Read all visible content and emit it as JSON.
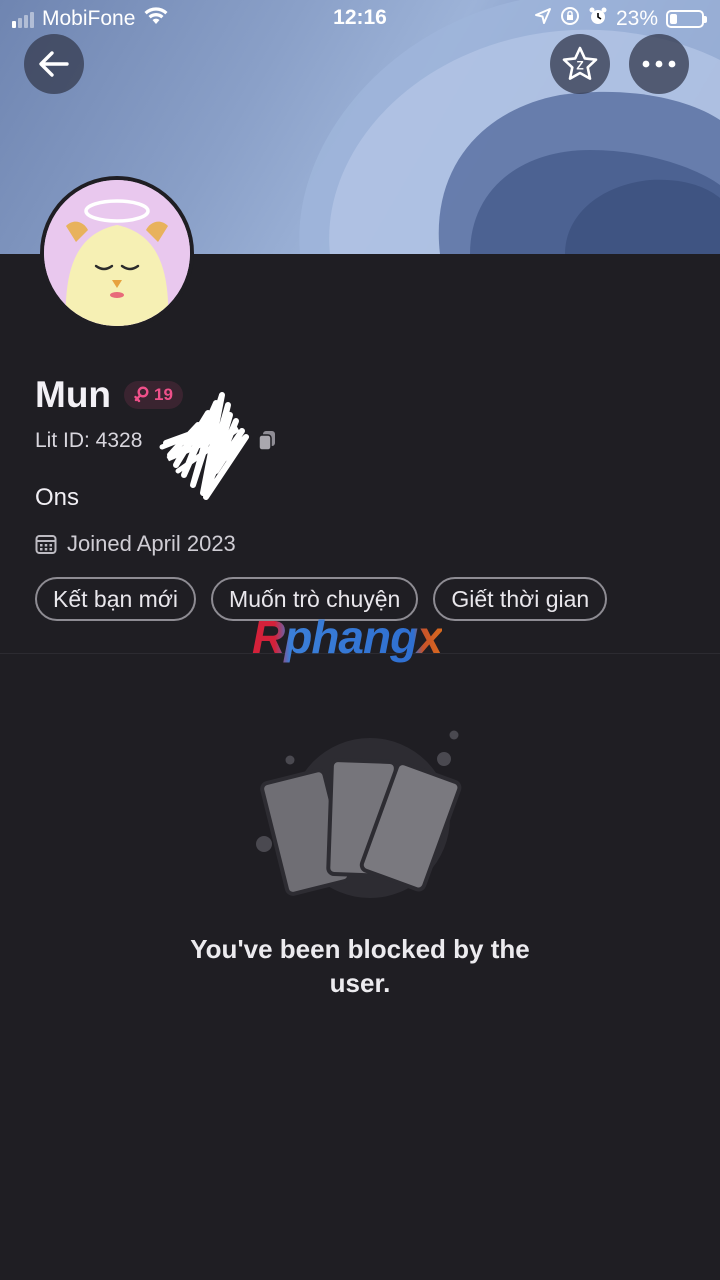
{
  "status_bar": {
    "carrier": "MobiFone",
    "time": "12:16",
    "battery_percent": "23%",
    "signal_bars_active": 1,
    "icons": [
      "signal-icon",
      "wifi-icon",
      "location-icon",
      "rotation-lock-icon",
      "alarm-icon",
      "battery-icon"
    ]
  },
  "header": {
    "back_icon": "back-arrow-icon",
    "star_icon": "star-icon",
    "more_icon": "more-dots-icon",
    "banner_colors": [
      "#6f85b1",
      "#9db3d8",
      "#5d72a0"
    ]
  },
  "profile": {
    "name": "Mun",
    "age": "19",
    "gender_icon": "female-icon",
    "lit_id_label": "Lit ID: 4328",
    "bio": "Ons",
    "joined": "Joined April 2023",
    "tags": [
      "Kết bạn mới",
      "Muốn trò chuyện",
      "Giết thời gian"
    ]
  },
  "watermark": "Rphangx",
  "empty_state": {
    "icon": "cards-icon",
    "message": "You've been blocked by the user."
  },
  "colors": {
    "background": "#1f1e23",
    "age_badge_text": "#f0508a",
    "age_badge_bg": "#3a2430",
    "avatar_bg": "#e9c8ee"
  }
}
